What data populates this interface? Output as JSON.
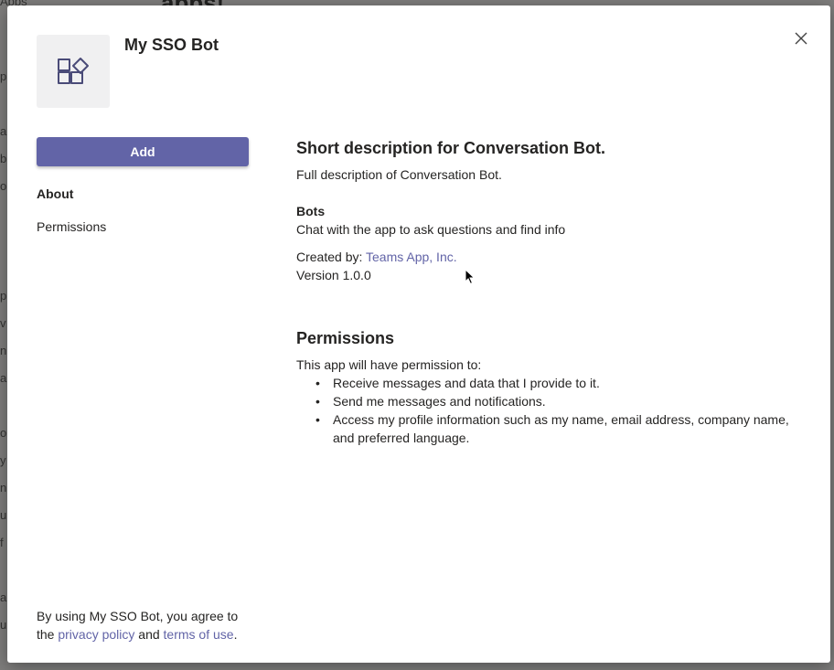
{
  "background": {
    "heading": "apps!",
    "letters": [
      "Apps",
      "p",
      "a",
      "b",
      "o",
      "p",
      "v",
      "n",
      "a",
      "o",
      "y",
      "n",
      "u",
      "f",
      "a",
      "u"
    ]
  },
  "dialog": {
    "app_title": "My SSO Bot",
    "app_icon": "apps-icon",
    "close_icon": "close-icon",
    "add_label": "Add",
    "nav": {
      "about": "About",
      "permissions": "Permissions"
    },
    "about": {
      "short_description": "Short description for Conversation Bot.",
      "full_description": "Full description of Conversation Bot.",
      "bots_title": "Bots",
      "bots_text": "Chat with the app to ask questions and find info",
      "created_by_label": "Created by:",
      "created_by_link": "Teams App, Inc.",
      "version": "Version 1.0.0"
    },
    "permissions": {
      "title": "Permissions",
      "intro": "This app will have permission to:",
      "items": [
        "Receive messages and data that I provide to it.",
        "Send me messages and notifications.",
        "Access my profile information such as my name, email address, company name, and preferred language."
      ]
    },
    "footer": {
      "text_before": "By using My SSO Bot, you agree to the",
      "privacy_link": "privacy policy",
      "and_text": "and",
      "terms_link": "terms of use",
      "period": "."
    }
  },
  "colors": {
    "accent": "#6264a7",
    "text": "#252423",
    "icon_bg": "#f0f0f1"
  }
}
